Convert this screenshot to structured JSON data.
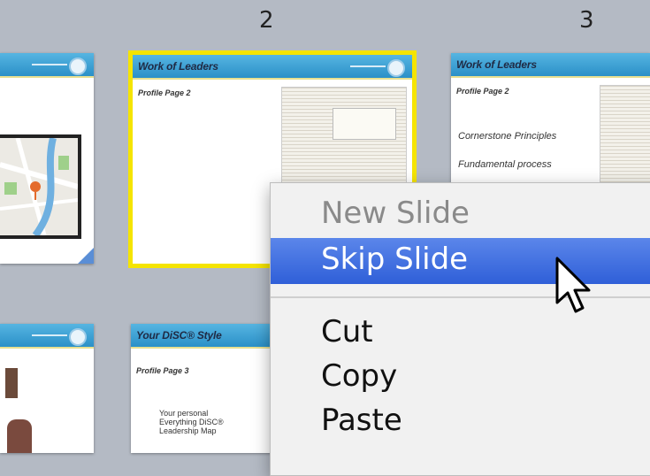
{
  "slide_numbers": [
    "2",
    "3"
  ],
  "slides": {
    "s1": {},
    "s2": {
      "title": "Work of Leaders",
      "subtitle": "Profile Page 2"
    },
    "s3": {
      "title": "Work of Leaders",
      "subtitle": "Profile Page 2",
      "lines": [
        "Cornerstone Principles",
        "Fundamental process"
      ]
    },
    "s5": {
      "title": "Your DiSC® Style",
      "subtitle": "Profile Page 3",
      "body": [
        "Your personal",
        "Everything DiSC®",
        "Leadership Map"
      ]
    }
  },
  "context_menu": {
    "items": [
      {
        "label": "New Slide",
        "enabled": false
      },
      {
        "label": "Skip Slide",
        "enabled": true,
        "highlighted": true
      },
      {
        "label": "Cut",
        "enabled": true
      },
      {
        "label": "Copy",
        "enabled": true
      },
      {
        "label": "Paste",
        "enabled": true
      }
    ]
  },
  "colors": {
    "background": "#b4bac4",
    "selection_border": "#f5e400",
    "menu_highlight": "#3b6de0",
    "slide_header": "#3aa0d6"
  }
}
